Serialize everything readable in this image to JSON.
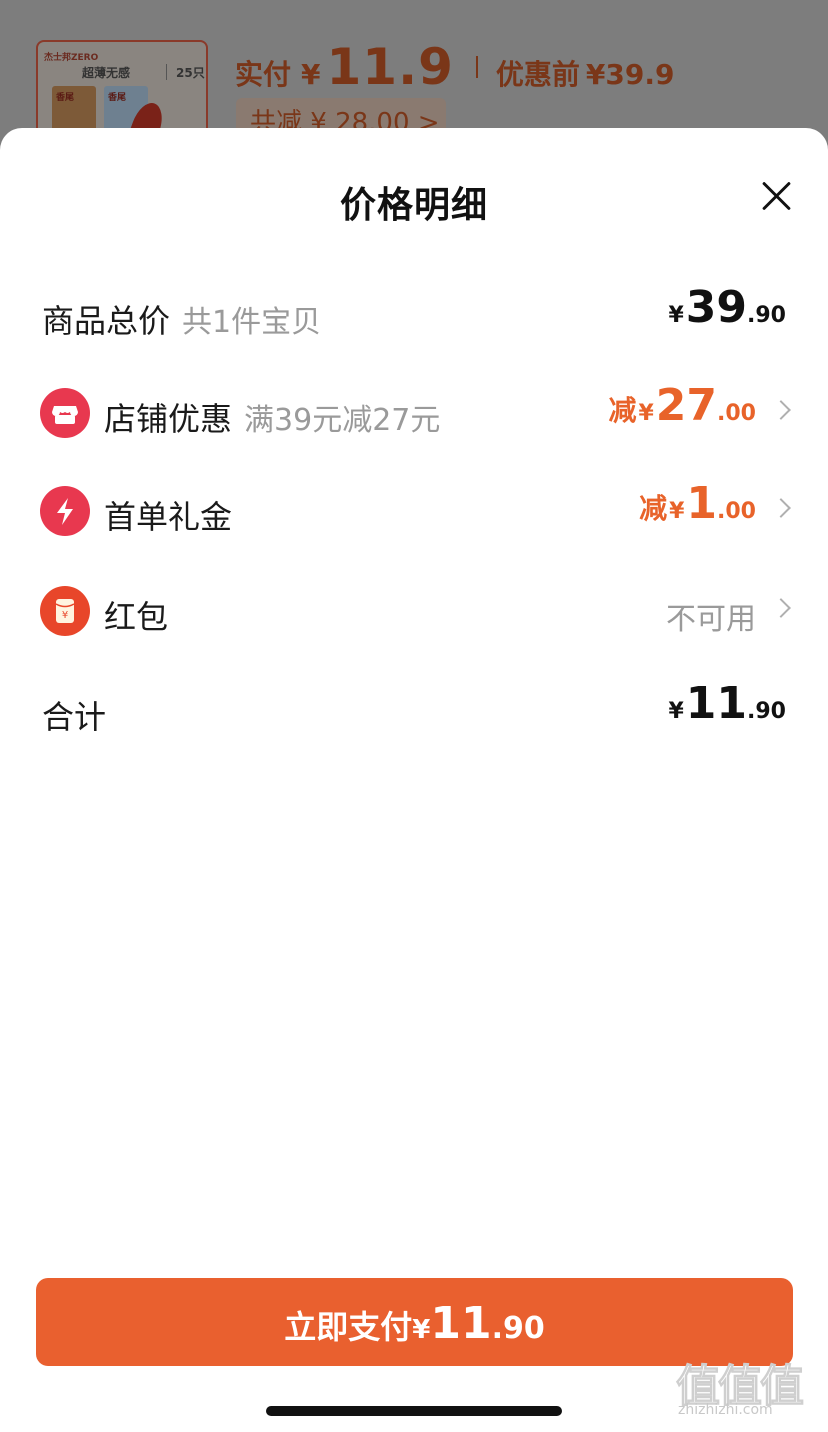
{
  "background": {
    "thumbnail": {
      "brand": "杰士邦ZERO",
      "title": "超薄无感",
      "count": "25只",
      "pack1_text": "香尾",
      "pack2_text": "香尾"
    },
    "price_label": "实付",
    "price_yen": "¥",
    "price_value": "11.9",
    "original_label": "优惠前",
    "original_price": "¥39.9",
    "total_discount": "共减 ¥ 28.00 >"
  },
  "sheet": {
    "title": "价格明细",
    "rows": [
      {
        "label": "商品总价",
        "sub": "共1件宝贝",
        "yen": "¥",
        "int": "39",
        "dec": ".90"
      },
      {
        "label": "店铺优惠",
        "sub": "满39元减27元",
        "prefix": "减",
        "yen": "¥",
        "int": "27",
        "dec": ".00",
        "icon": "store-icon",
        "icon_color": "#e8384f"
      },
      {
        "label": "首单礼金",
        "sub": "",
        "prefix": "减",
        "yen": "¥",
        "int": "1",
        "dec": ".00",
        "icon": "lightning-icon",
        "icon_color": "#e8384f"
      },
      {
        "label": "红包",
        "sub": "",
        "status": "不可用",
        "icon": "red-envelope-icon",
        "icon_color": "#e8462a"
      },
      {
        "label": "合计",
        "yen": "¥",
        "int": "11",
        "dec": ".90"
      }
    ],
    "pay_button": {
      "text": "立即支付",
      "yen": "¥",
      "int": "11",
      "dec": ".90"
    }
  },
  "watermark": {
    "glyphs": "值值值",
    "url": "zhizhizhi.com"
  },
  "colors": {
    "accent": "#e9602f",
    "discount": "#e8632a",
    "muted": "#9a9a9a"
  }
}
